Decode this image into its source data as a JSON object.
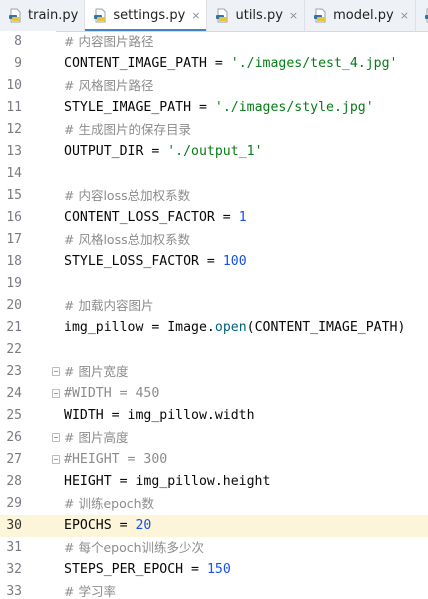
{
  "tabs": [
    {
      "name": "train.py",
      "active": false,
      "closable": false
    },
    {
      "name": "settings.py",
      "active": true,
      "closable": true
    },
    {
      "name": "utils.py",
      "active": false,
      "closable": true
    },
    {
      "name": "model.py",
      "active": false,
      "closable": true
    }
  ],
  "tab_close_glyph": "×",
  "current_line": 30,
  "lines": [
    {
      "n": "8",
      "tokens": [
        {
          "t": "comment",
          "v": "# 内容图片路径"
        }
      ]
    },
    {
      "n": "9",
      "tokens": [
        {
          "t": "plain",
          "v": "CONTENT_IMAGE_PATH "
        },
        {
          "t": "op",
          "v": "= "
        },
        {
          "t": "string",
          "v": "'./images/test_4.jpg'"
        }
      ]
    },
    {
      "n": "10",
      "tokens": [
        {
          "t": "comment",
          "v": "# 风格图片路径"
        }
      ]
    },
    {
      "n": "11",
      "tokens": [
        {
          "t": "plain",
          "v": "STYLE_IMAGE_PATH "
        },
        {
          "t": "op",
          "v": "= "
        },
        {
          "t": "string",
          "v": "'./images/style.jpg'"
        }
      ]
    },
    {
      "n": "12",
      "tokens": [
        {
          "t": "comment",
          "v": "# 生成图片的保存目录"
        }
      ]
    },
    {
      "n": "13",
      "tokens": [
        {
          "t": "plain",
          "v": "OUTPUT_DIR "
        },
        {
          "t": "op",
          "v": "= "
        },
        {
          "t": "string",
          "v": "'./output_1'"
        }
      ]
    },
    {
      "n": "14",
      "tokens": []
    },
    {
      "n": "15",
      "tokens": [
        {
          "t": "comment",
          "v": "# 内容loss总加权系数"
        }
      ]
    },
    {
      "n": "16",
      "tokens": [
        {
          "t": "plain",
          "v": "CONTENT_LOSS_FACTOR "
        },
        {
          "t": "op",
          "v": "= "
        },
        {
          "t": "number",
          "v": "1"
        }
      ]
    },
    {
      "n": "17",
      "tokens": [
        {
          "t": "comment",
          "v": "# 风格loss总加权系数"
        }
      ]
    },
    {
      "n": "18",
      "tokens": [
        {
          "t": "plain",
          "v": "STYLE_LOSS_FACTOR "
        },
        {
          "t": "op",
          "v": "= "
        },
        {
          "t": "number",
          "v": "100"
        }
      ]
    },
    {
      "n": "19",
      "tokens": []
    },
    {
      "n": "20",
      "tokens": [
        {
          "t": "comment",
          "v": "# 加载内容图片"
        }
      ]
    },
    {
      "n": "21",
      "tokens": [
        {
          "t": "plain",
          "v": "img_pillow "
        },
        {
          "t": "op",
          "v": "= "
        },
        {
          "t": "plain",
          "v": "Image."
        },
        {
          "t": "func",
          "v": "open"
        },
        {
          "t": "plain",
          "v": "(CONTENT_IMAGE_PATH)"
        }
      ]
    },
    {
      "n": "22",
      "tokens": []
    },
    {
      "n": "23",
      "fold": true,
      "tokens": [
        {
          "t": "comment",
          "v": "# 图片宽度"
        }
      ]
    },
    {
      "n": "24",
      "fold": true,
      "tokens": [
        {
          "t": "commentmono",
          "v": "#WIDTH = 450"
        }
      ]
    },
    {
      "n": "25",
      "tokens": [
        {
          "t": "plain",
          "v": "WIDTH "
        },
        {
          "t": "op",
          "v": "= "
        },
        {
          "t": "plain",
          "v": "img_pillow.width"
        }
      ]
    },
    {
      "n": "26",
      "fold": true,
      "tokens": [
        {
          "t": "comment",
          "v": "# 图片高度"
        }
      ]
    },
    {
      "n": "27",
      "fold": true,
      "tokens": [
        {
          "t": "commentmono",
          "v": "#HEIGHT = 300"
        }
      ]
    },
    {
      "n": "28",
      "tokens": [
        {
          "t": "plain",
          "v": "HEIGHT "
        },
        {
          "t": "op",
          "v": "= "
        },
        {
          "t": "plain",
          "v": "img_pillow.height"
        }
      ]
    },
    {
      "n": "29",
      "tokens": [
        {
          "t": "comment",
          "v": "# 训练epoch数"
        }
      ]
    },
    {
      "n": "30",
      "tokens": [
        {
          "t": "plain",
          "v": "EPOCHS "
        },
        {
          "t": "op",
          "v": "= "
        },
        {
          "t": "number",
          "v": "20"
        }
      ]
    },
    {
      "n": "31",
      "tokens": [
        {
          "t": "comment",
          "v": "# 每个epoch训练多少次"
        }
      ]
    },
    {
      "n": "32",
      "tokens": [
        {
          "t": "plain",
          "v": "STEPS_PER_EPOCH "
        },
        {
          "t": "op",
          "v": "= "
        },
        {
          "t": "number",
          "v": "150"
        }
      ]
    },
    {
      "n": "33",
      "tokens": [
        {
          "t": "comment",
          "v": "# 学习率"
        }
      ]
    }
  ],
  "colors": {
    "comment": "#8c8c8c",
    "string": "#067d17",
    "number": "#1750eb",
    "function": "#00627a",
    "current_line_bg": "#fcf5d9",
    "tab_underline": "#4083c9"
  }
}
